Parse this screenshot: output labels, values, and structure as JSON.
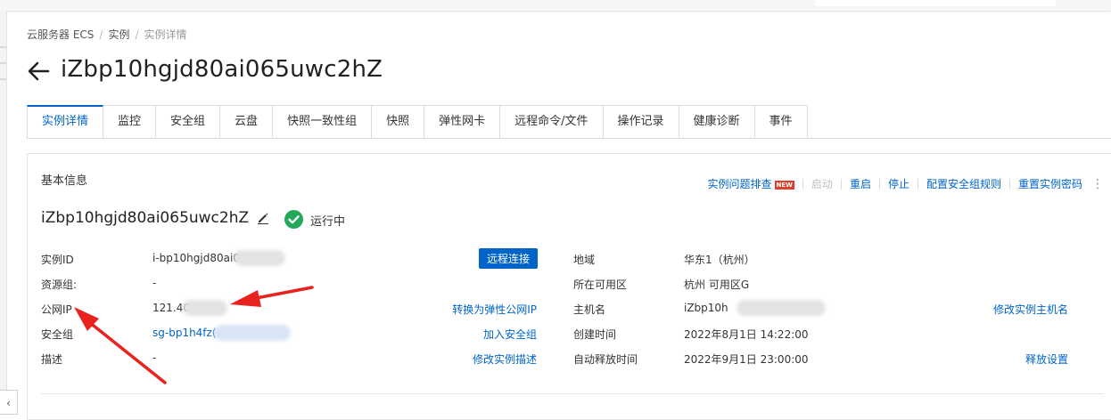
{
  "breadcrumb": {
    "item1": "云服务器 ECS",
    "item2": "实例",
    "item3": "实例详情",
    "separator": "/"
  },
  "page": {
    "title": "iZbp10hgjd80ai065uwc2hZ"
  },
  "tabs": [
    {
      "label": "实例详情",
      "active": true
    },
    {
      "label": "监控"
    },
    {
      "label": "安全组"
    },
    {
      "label": "云盘"
    },
    {
      "label": "快照一致性组"
    },
    {
      "label": "快照"
    },
    {
      "label": "弹性网卡"
    },
    {
      "label": "远程命令/文件"
    },
    {
      "label": "操作记录"
    },
    {
      "label": "健康诊断"
    },
    {
      "label": "事件"
    }
  ],
  "basic_info": {
    "section_title": "基本信息",
    "actions": {
      "troubleshoot": "实例问题排查",
      "new_badge": "NEW",
      "start": "启动",
      "restart": "重启",
      "stop": "停止",
      "configure_sg_rules": "配置安全组规则",
      "reset_password": "重置实例密码",
      "more": "⋮"
    },
    "instance_name": "iZbp10hgjd80ai065uwc2hZ",
    "status": "运行中",
    "remote_connect_label": "远程连接",
    "left": {
      "instance_id_label": "实例ID",
      "instance_id_value": "i-bp10hgjd80ai0",
      "resource_group_label": "资源组:",
      "resource_group_value": "-",
      "public_ip_label": "公网IP",
      "public_ip_value": "121.40",
      "public_ip_action": "转换为弹性公网IP",
      "security_group_label": "安全组",
      "security_group_value": "sg-bp1h4fz(",
      "security_group_action": "加入安全组",
      "description_label": "描述",
      "description_value": "-",
      "description_action": "修改实例描述"
    },
    "right": {
      "region_label": "地域",
      "region_value": "华东1（杭州）",
      "zone_label": "所在可用区",
      "zone_value": "杭州 可用区G",
      "hostname_label": "主机名",
      "hostname_value": "iZbp10h",
      "hostname_action": "修改实例主机名",
      "created_label": "创建时间",
      "created_value": "2022年8月1日 14:22:00",
      "auto_release_label": "自动释放时间",
      "auto_release_value": "2022年9月1日 23:00:00",
      "auto_release_action": "释放设置"
    }
  },
  "colors": {
    "accent": "#0064c8",
    "success": "#23a85a",
    "annotation_arrow": "#e8231f",
    "badge": "#e03e2d"
  },
  "icons": {
    "back": "arrow-left-icon",
    "edit": "pencil-icon",
    "status": "check-circle-icon",
    "collapse": "chevron-left-icon"
  }
}
